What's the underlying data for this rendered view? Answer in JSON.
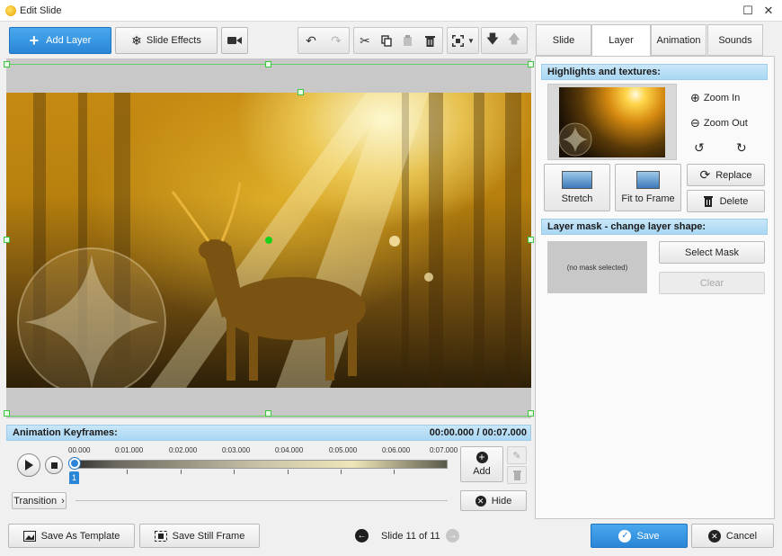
{
  "window": {
    "title": "Edit Slide"
  },
  "toolbar": {
    "add_layer": "Add Layer",
    "slide_effects": "Slide Effects"
  },
  "tabs": [
    {
      "label": "Slide"
    },
    {
      "label": "Layer"
    },
    {
      "label": "Animation"
    },
    {
      "label": "Sounds"
    }
  ],
  "panel": {
    "highlights_header": "Highlights and textures:",
    "zoom_in": "Zoom In",
    "zoom_out": "Zoom Out",
    "stretch": "Stretch",
    "fit_to_frame": "Fit to Frame",
    "replace": "Replace",
    "delete": "Delete",
    "mask_header": "Layer mask - change layer shape:",
    "no_mask": "(no mask selected)",
    "select_mask": "Select Mask",
    "clear": "Clear"
  },
  "timeline": {
    "header": "Animation Keyframes:",
    "time_current": "00:00.000",
    "time_total": "00:07.000",
    "time_separator": "/",
    "ticks": [
      "00.000",
      "0:01.000",
      "0:02.000",
      "0:03.000",
      "0:04.000",
      "0:05.000",
      "0:06.000",
      "0:07.000"
    ],
    "keyframe_label": "1",
    "add": "Add",
    "transition": "Transition",
    "hide": "Hide"
  },
  "footer": {
    "save_template": "Save As Template",
    "save_still": "Save Still Frame",
    "slide_counter": "Slide 11 of 11",
    "save": "Save",
    "cancel": "Cancel"
  },
  "colors": {
    "accent": "#2a86d6",
    "header_blue": "#b5dcf4",
    "guide_green": "#3ec43e"
  }
}
